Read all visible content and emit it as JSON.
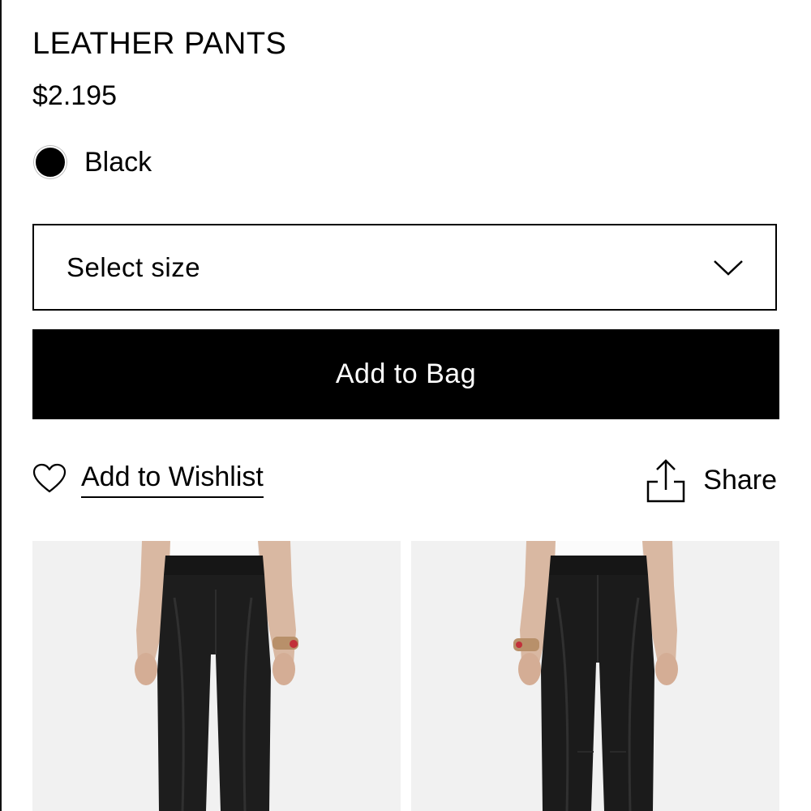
{
  "product": {
    "title": "LEATHER PANTS",
    "price": "$2.195",
    "color": {
      "name": "Black",
      "swatch_hex": "#000000"
    }
  },
  "size_select": {
    "label": "Select size",
    "icon": "chevron-down-icon"
  },
  "add_to_bag": {
    "label": "Add to Bag",
    "background": "#000000",
    "text_color": "#ffffff"
  },
  "wishlist": {
    "label": "Add to Wishlist",
    "icon": "heart-icon"
  },
  "share": {
    "label": "Share",
    "icon": "share-icon"
  },
  "gallery": {
    "images": [
      {
        "view": "front",
        "icon": "product-photo"
      },
      {
        "view": "back",
        "icon": "product-photo"
      }
    ],
    "background": "#f1f1f1"
  }
}
